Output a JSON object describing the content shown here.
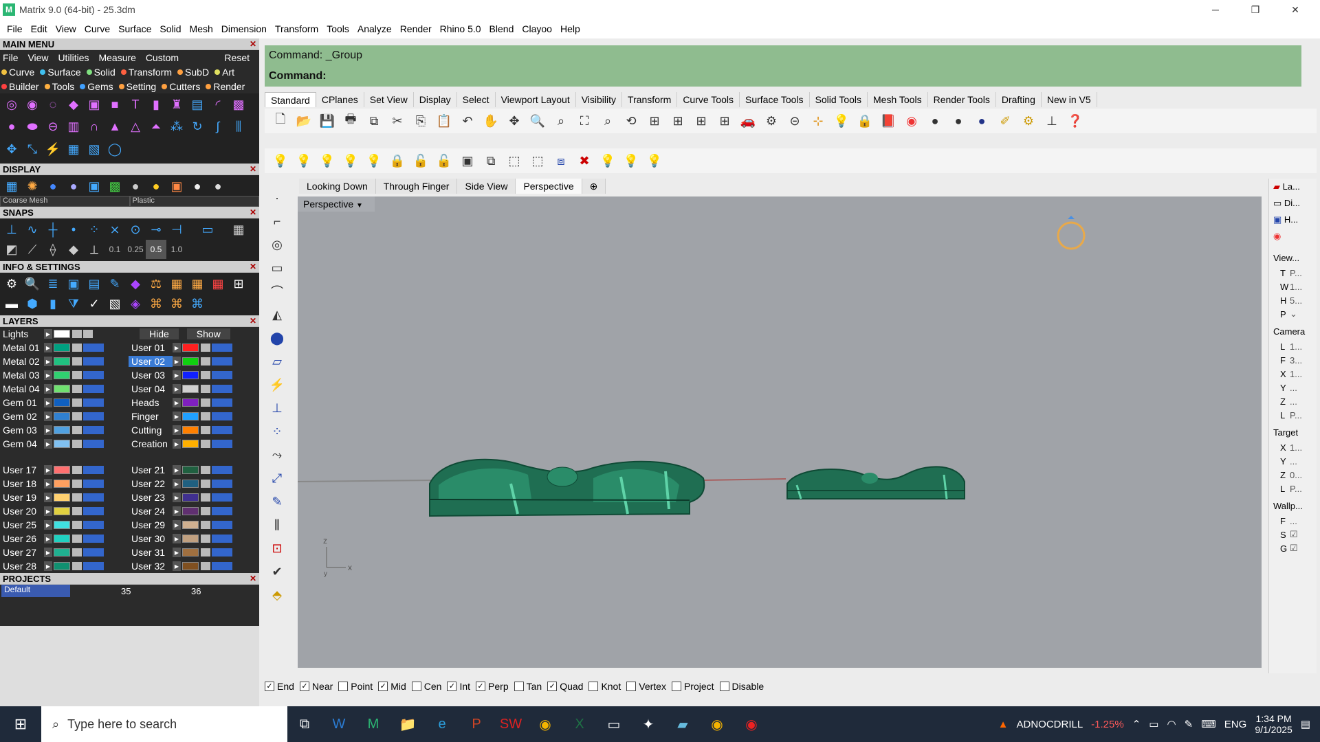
{
  "window": {
    "title": "Matrix 9.0 (64-bit) - 25.3dm",
    "app_icon_letter": "M"
  },
  "menubar": [
    "File",
    "Edit",
    "View",
    "Curve",
    "Surface",
    "Solid",
    "Mesh",
    "Dimension",
    "Transform",
    "Tools",
    "Analyze",
    "Render",
    "Rhino 5.0",
    "Blend",
    "Clayoo",
    "Help"
  ],
  "left": {
    "main_menu": "MAIN MENU",
    "sub": [
      "File",
      "View",
      "Utilities",
      "Measure",
      "Custom"
    ],
    "reset": "Reset",
    "row1": [
      {
        "label": "Curve",
        "color": "#f0c040"
      },
      {
        "label": "Surface",
        "color": "#40c0f0"
      },
      {
        "label": "Solid",
        "color": "#80e080"
      },
      {
        "label": "Transform",
        "color": "#ff6040"
      },
      {
        "label": "SubD",
        "color": "#ffa040"
      },
      {
        "label": "Art",
        "color": "#e0e060"
      }
    ],
    "row2": [
      {
        "label": "Builder",
        "color": "#ff4040"
      },
      {
        "label": "Tools",
        "color": "#ffb040"
      },
      {
        "label": "Gems",
        "color": "#40a0ff"
      },
      {
        "label": "Setting",
        "color": "#ffa040"
      },
      {
        "label": "Cutters",
        "color": "#ffa040"
      },
      {
        "label": "Render",
        "color": "#ffa040"
      }
    ],
    "display": "DISPLAY",
    "display_mesh": "Coarse Mesh",
    "display_mat": "Plastic",
    "snaps": "SNAPS",
    "snap_vals": [
      "0.1",
      "0.25",
      "0.5",
      "1.0"
    ],
    "info": "INFO & SETTINGS",
    "layers": "LAYERS",
    "lights": "Lights",
    "hide": "Hide",
    "show": "Show",
    "layer_pairs": [
      [
        "Metal 01",
        "User 01",
        "#00a080",
        "#ff2020"
      ],
      [
        "Metal 02",
        "User 02",
        "#20c080",
        "#10d010"
      ],
      [
        "Metal 03",
        "User 03",
        "#30d070",
        "#1020ff"
      ],
      [
        "Metal 04",
        "User 04",
        "#70e070",
        "#d0d0d0"
      ],
      [
        "Gem 01",
        "Heads",
        "#1060c0",
        "#8020c0"
      ],
      [
        "Gem 02",
        "Finger",
        "#3080d0",
        "#20a0ff"
      ],
      [
        "Gem 03",
        "Cutting",
        "#50a0e0",
        "#ff8000"
      ],
      [
        "Gem 04",
        "Creation",
        "#80c0f0",
        "#ffb000"
      ],
      [
        "User 17",
        "User 21",
        "#ff7070",
        "#206040"
      ],
      [
        "User 18",
        "User 22",
        "#ffa060",
        "#206080"
      ],
      [
        "User 19",
        "User 23",
        "#ffd070",
        "#403090"
      ],
      [
        "User 20",
        "User 24",
        "#e0d040",
        "#603070"
      ],
      [
        "User 25",
        "User 29",
        "#40e0e0",
        "#d0b090"
      ],
      [
        "User 26",
        "User 30",
        "#20d0c0",
        "#c0a080"
      ],
      [
        "User 27",
        "User 31",
        "#20b090",
        "#a07040"
      ],
      [
        "User 28",
        "User 32",
        "#109070",
        "#805020"
      ]
    ],
    "projects": "PROJECTS",
    "project_default": "Default",
    "project_nums": [
      "35",
      "36"
    ]
  },
  "command": {
    "history": "Command: _Group",
    "prompt": "Command:"
  },
  "tabs": [
    "Standard",
    "CPlanes",
    "Set View",
    "Display",
    "Select",
    "Viewport Layout",
    "Visibility",
    "Transform",
    "Curve Tools",
    "Surface Tools",
    "Solid Tools",
    "Mesh Tools",
    "Render Tools",
    "Drafting",
    "New in V5"
  ],
  "viewtabs": [
    "Looking Down",
    "Through Finger",
    "Side View",
    "Perspective"
  ],
  "viewport": {
    "label": "Perspective",
    "axis_z": "z",
    "axis_x": "x",
    "axis_y": "y"
  },
  "osnaps": [
    {
      "label": "End",
      "checked": true
    },
    {
      "label": "Near",
      "checked": true
    },
    {
      "label": "Point",
      "checked": false
    },
    {
      "label": "Mid",
      "checked": true
    },
    {
      "label": "Cen",
      "checked": false
    },
    {
      "label": "Int",
      "checked": true
    },
    {
      "label": "Perp",
      "checked": true
    },
    {
      "label": "Tan",
      "checked": false
    },
    {
      "label": "Quad",
      "checked": true
    },
    {
      "label": "Knot",
      "checked": false
    },
    {
      "label": "Vertex",
      "checked": false
    },
    {
      "label": "Project",
      "checked": false
    },
    {
      "label": "Disable",
      "checked": false
    }
  ],
  "sidebar": {
    "tabs": [
      "La...",
      "Di...",
      "H..."
    ],
    "view": "View...",
    "view_props": [
      [
        "T",
        "P..."
      ],
      [
        "W",
        "1..."
      ],
      [
        "H",
        "5..."
      ],
      [
        "P",
        ""
      ]
    ],
    "camera": "Camera",
    "camera_props": [
      [
        "L",
        "1..."
      ],
      [
        "F",
        "3..."
      ],
      [
        "X",
        "1..."
      ],
      [
        "Y",
        "..."
      ],
      [
        "Z",
        "..."
      ],
      [
        "L",
        "P..."
      ]
    ],
    "target": "Target",
    "target_props": [
      [
        "X",
        "1..."
      ],
      [
        "Y",
        "..."
      ],
      [
        "Z",
        "0..."
      ],
      [
        "L",
        "P..."
      ]
    ],
    "wallp": "Wallp...",
    "wallp_props": [
      [
        "F",
        "..."
      ],
      [
        "S",
        "☑"
      ],
      [
        "G",
        "☑"
      ]
    ]
  },
  "taskbar": {
    "search": "Type here to search",
    "stock_name": "ADNOCDRILL",
    "stock_change": "-1.25%",
    "lang": "ENG",
    "time": "1:34 PM",
    "date": "9/1/2025"
  }
}
